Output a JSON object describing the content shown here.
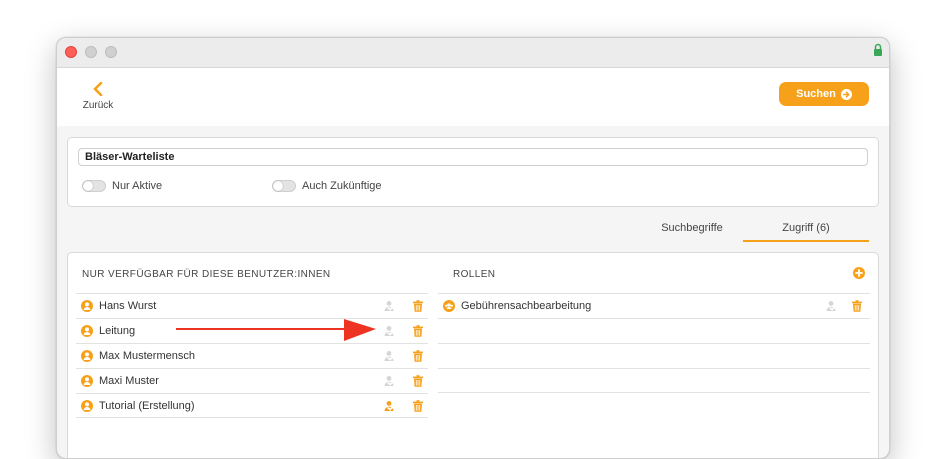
{
  "header": {
    "back_label": "Zurück",
    "search_label": "Suchen"
  },
  "filter": {
    "name_value": "Bläser-Warteliste",
    "toggles": [
      {
        "label": "Nur Aktive",
        "on": false
      },
      {
        "label": "Auch Zukünftige",
        "on": false
      }
    ]
  },
  "tabs": [
    {
      "label": "Suchbegriffe",
      "active": false
    },
    {
      "label": "Zugriff (6)",
      "active": true
    }
  ],
  "users": {
    "title": "NUR VERFÜGBAR FÜR DIESE BENUTZER:INNEN",
    "items": [
      {
        "label": "Hans Wurst",
        "owner_active": false
      },
      {
        "label": "Leitung",
        "owner_active": false
      },
      {
        "label": "Max Mustermensch",
        "owner_active": false
      },
      {
        "label": "Maxi Muster",
        "owner_active": false
      },
      {
        "label": "Tutorial (Erstellung)",
        "owner_active": true
      }
    ]
  },
  "roles": {
    "title": "ROLLEN",
    "items": [
      {
        "label": "Gebührensachbearbeitung",
        "owner_active": false
      }
    ]
  },
  "colors": {
    "accent": "#f7a11a",
    "annotation_arrow": "#ee3322",
    "lock": "#3aa757"
  }
}
